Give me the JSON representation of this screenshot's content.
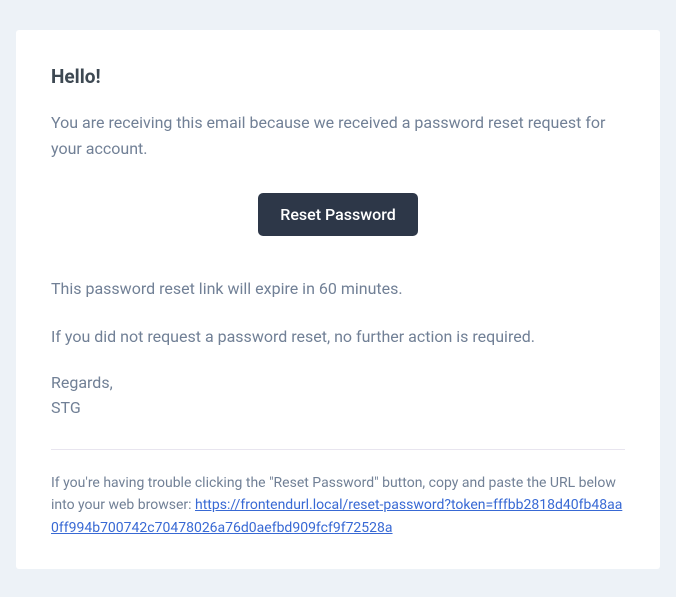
{
  "greeting": "Hello!",
  "intro": "You are receiving this email because we received a password reset request for your account.",
  "button_label": "Reset Password",
  "expiry_text": "This password reset link will expire in 60 minutes.",
  "no_request_text": "If you did not request a password reset, no further action is required.",
  "regards_label": "Regards,",
  "sender_name": "STG",
  "subcopy_prefix": "If you're having trouble clicking the \"Reset Password\" button, copy and paste the URL below into your web browser: ",
  "reset_url": "https://frontendurl.local/reset-password?token=fffbb2818d40fb48aa0ff994b700742c70478026a76d0aefbd909fcf9f72528a"
}
